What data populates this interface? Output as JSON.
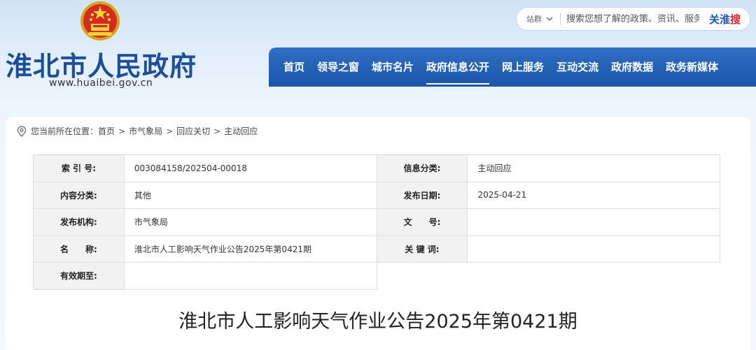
{
  "header": {
    "emblem_icon": "national-emblem-icon",
    "title": "淮北市人民政府",
    "url": "www.huaibei.gov.cn"
  },
  "search": {
    "scope": "站群",
    "placeholder": "搜索您想了解的政策、资讯、服务",
    "brand_blue": "关淮",
    "brand_red": "搜"
  },
  "nav": {
    "items": [
      "首页",
      "领导之窗",
      "城市名片",
      "政府信息公开",
      "网上服务",
      "互动交流",
      "政府数据",
      "政务新媒体"
    ],
    "active": "政府信息公开"
  },
  "breadcrumb": {
    "prefix": "您当前所在位置：",
    "items": [
      "首页",
      "市气象局",
      "回应关切",
      "主动回应"
    ],
    "separator": ">"
  },
  "meta": {
    "index_label": "索 引 号:",
    "index_value": "003084158/202504-00018",
    "category_label": "信息分类:",
    "category_value": "主动回应",
    "content_label": "内容分类:",
    "content_value": "其他",
    "date_label": "发布日期:",
    "date_value": "2025-04-21",
    "org_label": "发布机构:",
    "org_value": "市气象局",
    "docno_label": "文　　号:",
    "docno_value": "",
    "name_label": "名　　称:",
    "name_value": "淮北市人工影响天气作业公告2025年第0421期",
    "keyword_label": "关 键 词:",
    "keyword_value": "",
    "valid_label": "有效期至:",
    "valid_value": ""
  },
  "document": {
    "title": "淮北市人工影响天气作业公告2025年第0421期"
  },
  "colors": {
    "brand_blue": "#1b4f9c",
    "nav_blue": "#1a55a8",
    "accent_red": "#e0252b"
  }
}
